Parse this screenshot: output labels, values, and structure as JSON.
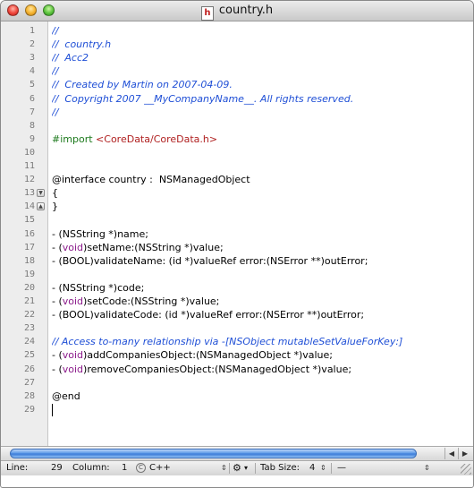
{
  "window": {
    "title": "country.h",
    "file_icon_letter": "h"
  },
  "editor": {
    "lines": [
      {
        "num": "1",
        "segments": [
          {
            "text": "//",
            "cls": "comment"
          }
        ]
      },
      {
        "num": "2",
        "segments": [
          {
            "text": "//  country.h",
            "cls": "comment"
          }
        ]
      },
      {
        "num": "3",
        "segments": [
          {
            "text": "//  Acc2",
            "cls": "comment"
          }
        ]
      },
      {
        "num": "4",
        "segments": [
          {
            "text": "//",
            "cls": "comment"
          }
        ]
      },
      {
        "num": "5",
        "segments": [
          {
            "text": "//  Created by Martin on 2007-04-09.",
            "cls": "comment"
          }
        ]
      },
      {
        "num": "6",
        "segments": [
          {
            "text": "//  Copyright 2007 __MyCompanyName__. All rights reserved.",
            "cls": "comment"
          }
        ]
      },
      {
        "num": "7",
        "segments": [
          {
            "text": "//",
            "cls": "comment"
          }
        ]
      },
      {
        "num": "8",
        "segments": []
      },
      {
        "num": "9",
        "segments": [
          {
            "text": "#import ",
            "cls": "directive"
          },
          {
            "text": "<CoreData/CoreData.h>",
            "cls": "string"
          }
        ]
      },
      {
        "num": "10",
        "segments": []
      },
      {
        "num": "11",
        "segments": []
      },
      {
        "num": "12",
        "segments": [
          {
            "text": "@interface country :  NSManagedObject",
            "cls": ""
          }
        ]
      },
      {
        "num": "13",
        "segments": [
          {
            "text": "{",
            "cls": ""
          }
        ],
        "fold": "open"
      },
      {
        "num": "14",
        "segments": [
          {
            "text": "}",
            "cls": ""
          }
        ],
        "fold": "close"
      },
      {
        "num": "15",
        "segments": []
      },
      {
        "num": "16",
        "segments": [
          {
            "text": "- (NSString *)name;",
            "cls": ""
          }
        ]
      },
      {
        "num": "17",
        "segments": [
          {
            "text": "- (",
            "cls": ""
          },
          {
            "text": "void",
            "cls": "keyword"
          },
          {
            "text": ")setName:(NSString *)value;",
            "cls": ""
          }
        ]
      },
      {
        "num": "18",
        "segments": [
          {
            "text": "- (BOOL)validateName: (id *)valueRef error:(NSError **)outError;",
            "cls": ""
          }
        ]
      },
      {
        "num": "19",
        "segments": []
      },
      {
        "num": "20",
        "segments": [
          {
            "text": "- (NSString *)code;",
            "cls": ""
          }
        ]
      },
      {
        "num": "21",
        "segments": [
          {
            "text": "- (",
            "cls": ""
          },
          {
            "text": "void",
            "cls": "keyword"
          },
          {
            "text": ")setCode:(NSString *)value;",
            "cls": ""
          }
        ]
      },
      {
        "num": "22",
        "segments": [
          {
            "text": "- (BOOL)validateCode: (id *)valueRef error:(NSError **)outError;",
            "cls": ""
          }
        ]
      },
      {
        "num": "23",
        "segments": []
      },
      {
        "num": "24",
        "segments": [
          {
            "text": "// Access to-many relationship via -[NSObject mutableSetValueForKey:]",
            "cls": "comment"
          }
        ]
      },
      {
        "num": "25",
        "segments": [
          {
            "text": "- (",
            "cls": ""
          },
          {
            "text": "void",
            "cls": "keyword"
          },
          {
            "text": ")addCompaniesObject:(NSManagedObject *)value;",
            "cls": ""
          }
        ]
      },
      {
        "num": "26",
        "segments": [
          {
            "text": "- (",
            "cls": ""
          },
          {
            "text": "void",
            "cls": "keyword"
          },
          {
            "text": ")removeCompaniesObject:(NSManagedObject *)value;",
            "cls": ""
          }
        ]
      },
      {
        "num": "27",
        "segments": []
      },
      {
        "num": "28",
        "segments": [
          {
            "text": "@end",
            "cls": ""
          }
        ]
      },
      {
        "num": "29",
        "segments": [],
        "caret": true
      }
    ]
  },
  "scroll": {
    "left_arrow": "◀",
    "right_arrow": "▶"
  },
  "status": {
    "line_label": "Line:",
    "line_value": "29",
    "column_label": "Column:",
    "column_value": "1",
    "language": "C++",
    "tab_size_label": "Tab Size:",
    "tab_size_value": "4",
    "extra": "—",
    "updown_glyph": "⇕",
    "gear_glyph": "⚙",
    "menu_arrow": "▾"
  }
}
